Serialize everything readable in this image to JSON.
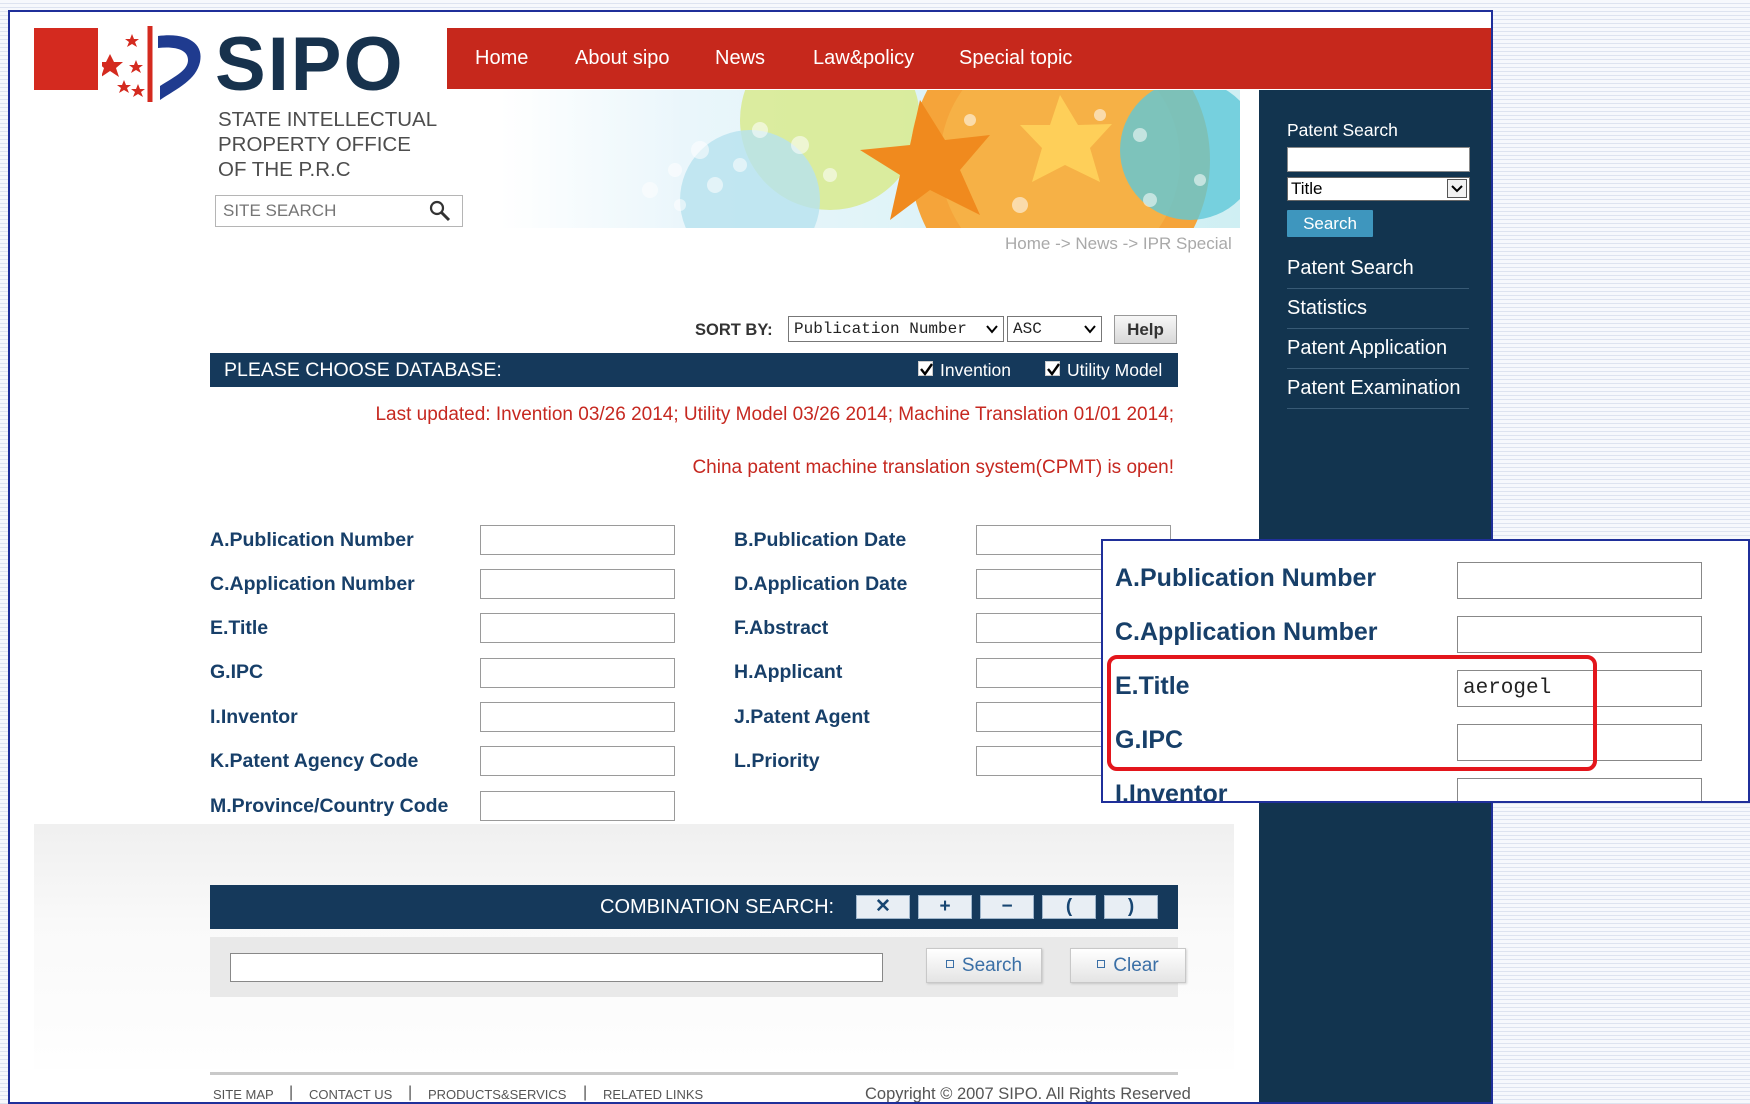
{
  "header": {
    "logo_text": "SIPO",
    "office_lines": [
      "STATE INTELLECTUAL",
      "PROPERTY OFFICE",
      "OF THE P.R.C"
    ],
    "site_search_placeholder": "SITE SEARCH",
    "nav": [
      "Home",
      "About sipo",
      "News",
      "Law&policy",
      "Special topic"
    ],
    "breadcrumb": "Home -> News -> IPR Special"
  },
  "sidebar": {
    "title": "Patent Search",
    "select_value": "Title",
    "search_label": "Search",
    "links": [
      "Patent Search",
      "Statistics",
      "Patent Application",
      "Patent Examination"
    ]
  },
  "sort": {
    "label": "SORT BY:",
    "field": "Publication Number",
    "order": "ASC",
    "help": "Help"
  },
  "database": {
    "label": "PLEASE CHOOSE DATABASE:",
    "options": [
      {
        "label": "Invention",
        "checked": true
      },
      {
        "label": "Utility Model",
        "checked": true
      }
    ]
  },
  "notices": {
    "last_updated": "Last updated:   Invention 03/26 2014; Utility Model 03/26 2014; Machine Translation 01/01 2014;",
    "cpmt": "China patent machine translation system(CPMT) is open!"
  },
  "fields": {
    "left": [
      "A.Publication Number",
      "C.Application Number",
      "E.Title",
      "G.IPC",
      "I.Inventor",
      "K.Patent Agency Code",
      "M.Province/Country Code"
    ],
    "right": [
      "B.Publication Date",
      "D.Application Date",
      "F.Abstract",
      "H.Applicant",
      "J.Patent Agent",
      "L.Priority"
    ]
  },
  "combination": {
    "label": "COMBINATION SEARCH:",
    "operators": [
      "✕",
      "+",
      "−",
      "(",
      ")"
    ],
    "search_label": "Search",
    "clear_label": "Clear"
  },
  "footer": {
    "links": [
      "SITE MAP",
      "CONTACT US",
      "PRODUCTS&SERVICS",
      "RELATED LINKS"
    ],
    "copyright": "Copyright © 2007 SIPO. All Rights Reserved"
  },
  "zoom": {
    "labels": [
      "A.Publication Number",
      "C.Application Number",
      "E.Title",
      "G.IPC",
      "I.Inventor"
    ],
    "title_value": "aerogel"
  },
  "colors": {
    "nav_red": "#c6281c",
    "sidebar_navy": "#12344f",
    "bar_navy": "#15395b",
    "label_blue": "#173f69",
    "notice_red": "#c62820",
    "highlight_red": "#e3161c"
  }
}
